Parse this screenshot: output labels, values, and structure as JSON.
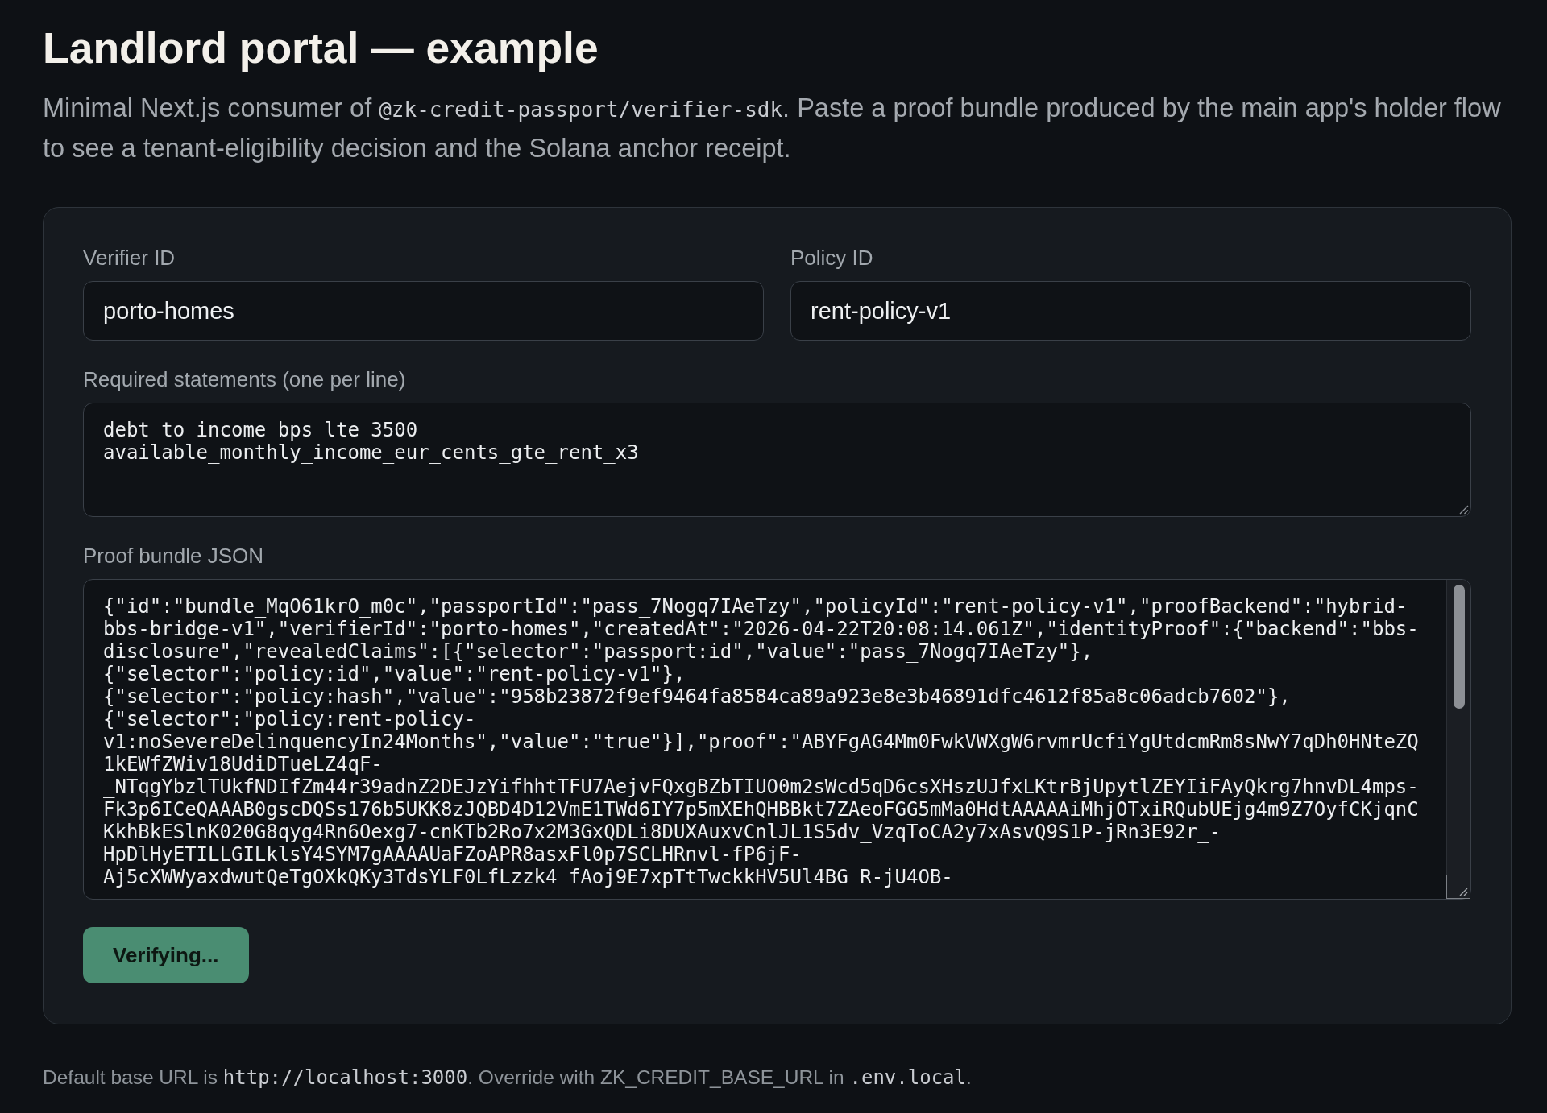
{
  "title": "Landlord portal — example",
  "description": [
    {
      "kind": "text",
      "text": "Minimal Next.js consumer of "
    },
    {
      "kind": "code",
      "text": "@zk-credit-passport/verifier-sdk"
    },
    {
      "kind": "text",
      "text": ". Paste a proof bundle produced by the main app's holder flow to see a tenant-eligibility decision and the Solana anchor receipt."
    }
  ],
  "form": {
    "fields": [
      {
        "kind": "input",
        "label": "Verifier ID",
        "value": "porto-homes"
      },
      {
        "kind": "input",
        "label": "Policy ID",
        "value": "rent-policy-v1"
      },
      {
        "kind": "textarea",
        "label": "Required statements (one per line)",
        "value": "debt_to_income_bps_lte_3500\navailable_monthly_income_eur_cents_gte_rent_x3"
      },
      {
        "kind": "scrollbox",
        "label": "Proof bundle JSON",
        "value": "{\"id\":\"bundle_MqO61krO_m0c\",\"passportId\":\"pass_7Nogq7IAeTzy\",\"policyId\":\"rent-policy-v1\",\"proofBackend\":\"hybrid-bbs-bridge-v1\",\"verifierId\":\"porto-homes\",\"createdAt\":\"2026-04-22T20:08:14.061Z\",\"identityProof\":{\"backend\":\"bbs-disclosure\",\"revealedClaims\":[{\"selector\":\"passport:id\",\"value\":\"pass_7Nogq7IAeTzy\"},{\"selector\":\"policy:id\",\"value\":\"rent-policy-v1\"},{\"selector\":\"policy:hash\",\"value\":\"958b23872f9ef9464fa8584ca89a923e8e3b46891dfc4612f85a8c06adcb7602\"},{\"selector\":\"policy:rent-policy-v1:noSevereDelinquencyIn24Months\",\"value\":\"true\"}],\"proof\":\"ABYFgAG4Mm0FwkVWXgW6rvmrUcfiYgUtdcmRm8sNwY7qDh0HNteZQ1kEWfZWiv18UdiDTueLZ4qF-_NTqgYbzlTUkfNDIfZm44r39adnZ2DEJzYifhhtTFU7AejvFQxgBZbTIUO0m2sWcd5qD6csXHszUJfxLKtrBjUpytlZEYIiFAyQkrg7hnvDL4mps-Fk3p6ICeQAAAB0gscDQSs176b5UKK8zJQBD4D12VmE1TWd6IY7p5mXEhQHBBkt7ZAeoFGG5mMa0HdtAAAAAiMhjOTxiRQubUEjg4m9Z7OyfCKjqnCKkhBkESlnK020G8qyg4Rn6Oexg7-cnKTb2Ro7x2M3GxQDLi8DUXAuxvCnlJL1S5dv_VzqToCA2y7xAsvQ9S1P-jRn3E92r_-HpDlHyETILLGILklsY4SYM7gAAAAUaFZoAPR8asxFl0p7SCLHRnvl-fP6jF-Aj5cXWWyaxdwutQeTgOXkQKy3TdsYLF0LfLzzk4_fAoj9E7xpTtTwckkHV5Ul4BG_R-jU4OB-"
      }
    ],
    "submit_button": {
      "label": "Verifying...",
      "disabled": true
    }
  },
  "footer_note": [
    {
      "kind": "text",
      "text": "Default base URL is "
    },
    {
      "kind": "code",
      "text": "http://localhost:3000"
    },
    {
      "kind": "text",
      "text": ". Override with ZK_CREDIT_BASE_URL in "
    },
    {
      "kind": "code",
      "text": ".env.local"
    },
    {
      "kind": "text",
      "text": "."
    }
  ]
}
